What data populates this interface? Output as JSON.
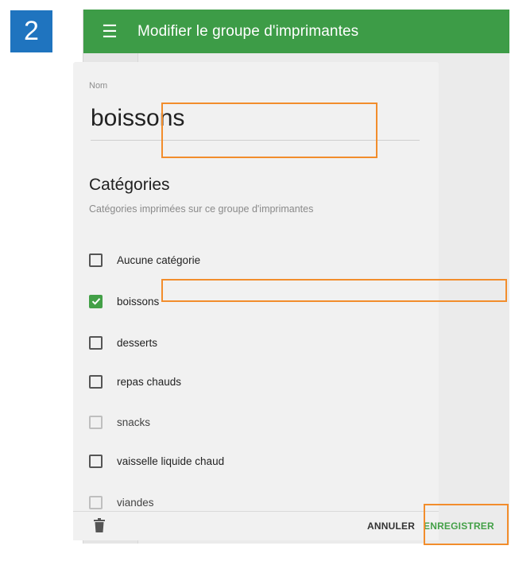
{
  "step_badge": "2",
  "topbar": {
    "title": "Modifier le groupe d'imprimantes"
  },
  "sidebar": {
    "items": [
      {
        "icon": "account-circle-icon",
        "color": "#616161"
      },
      {
        "icon": "bar-chart-icon",
        "color": "#43a047"
      },
      {
        "icon": "shopping-basket-icon",
        "color": "#e91e63"
      },
      {
        "icon": "hand-truck-icon",
        "color": "#1e88e5"
      },
      {
        "icon": "contact-card-icon",
        "color": "#00897b"
      },
      {
        "icon": "people-icon",
        "color": "#3f51b5"
      },
      {
        "icon": "gear-icon",
        "color": "#546e7a"
      },
      {
        "icon": "help-circle-icon",
        "color": "#0288d1"
      }
    ]
  },
  "form": {
    "name_label": "Nom",
    "name_value": "boissons",
    "section_title": "Catégories",
    "section_subtitle": "Catégories imprimées sur ce groupe d'imprimantes",
    "categories": [
      {
        "label": "Aucune catégorie",
        "checked": false,
        "disabled": false
      },
      {
        "label": "boissons",
        "checked": true,
        "disabled": false
      },
      {
        "label": "desserts",
        "checked": false,
        "disabled": false
      },
      {
        "label": "repas chauds",
        "checked": false,
        "disabled": false
      },
      {
        "label": "snacks",
        "checked": false,
        "disabled": true
      },
      {
        "label": "vaisselle liquide chaud",
        "checked": false,
        "disabled": false
      },
      {
        "label": "viandes",
        "checked": false,
        "disabled": true
      }
    ]
  },
  "footer": {
    "cancel_label": "ANNULER",
    "save_label": "ENREGISTRER"
  },
  "colors": {
    "topbar": "#3d9c47",
    "accent_green": "#43a047",
    "highlight": "#f28d2c",
    "step_badge": "#1f74bf"
  }
}
